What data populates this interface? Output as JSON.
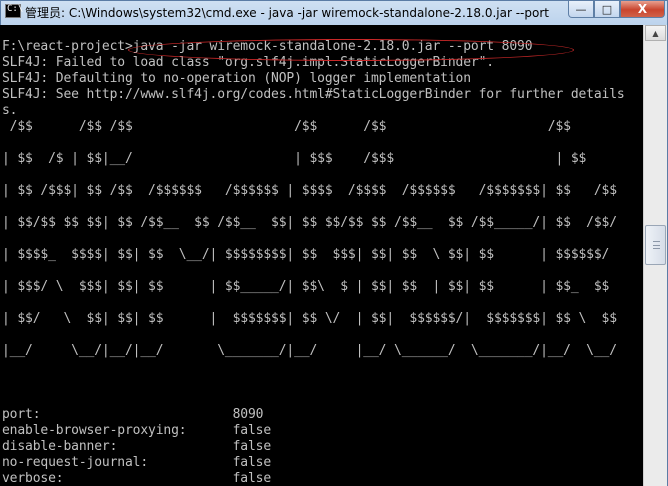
{
  "window": {
    "title": "管理员: C:\\Windows\\system32\\cmd.exe - java  -jar wiremock-standalone-2.18.0.jar --port 8...",
    "icon": "cmd-prompt-icon",
    "buttons": {
      "minimize": "—",
      "maximize": "□",
      "close": "X"
    }
  },
  "console": {
    "background": "#000000",
    "text_color": "#c0c0c0",
    "highlight_color": "#c82828",
    "lines": [
      "F:\\react-project>java -jar wiremock-standalone-2.18.0.jar --port 8090",
      "SLF4J: Failed to load class \"org.slf4j.impl.StaticLoggerBinder\".",
      "SLF4J: Defaulting to no-operation (NOP) logger implementation",
      "SLF4J: See http://www.slf4j.org/codes.html#StaticLoggerBinder for further details",
      "s.",
      " /$$      /$$ /$$                     /$$      /$$                     /$$",
      "",
      "| $$  /$ | $$|__/                     | $$$    /$$$                     | $$",
      "",
      "| $$ /$$$| $$ /$$  /$$$$$$   /$$$$$$ | $$$$  /$$$$  /$$$$$$   /$$$$$$$| $$   /$$",
      "",
      "| $$/$$ $$ $$| $$ /$$__  $$ /$$__  $$| $$ $$/$$ $$ /$$__  $$ /$$_____/| $$  /$$/",
      "",
      "| $$$$_  $$$$| $$| $$  \\__/| $$$$$$$$| $$  $$$| $$| $$  \\ $$| $$      | $$$$$$/",
      "",
      "| $$$/ \\  $$$| $$| $$      | $$_____/| $$\\  $ | $$| $$  | $$| $$      | $$_  $$",
      "",
      "| $$/   \\  $$| $$| $$      |  $$$$$$$| $$ \\/  | $$|  $$$$$$/|  $$$$$$$| $$ \\  $$",
      "",
      "|__/     \\__/|__/|__/       \\_______/|__/     |__/ \\______/  \\_______/|__/  \\__/",
      "",
      "",
      "",
      "port:                         8090",
      "enable-browser-proxying:      false",
      "disable-banner:               false",
      "no-request-journal:           false",
      "verbose:                      false"
    ]
  },
  "scrollbar": {
    "up_arrow": "▲"
  }
}
